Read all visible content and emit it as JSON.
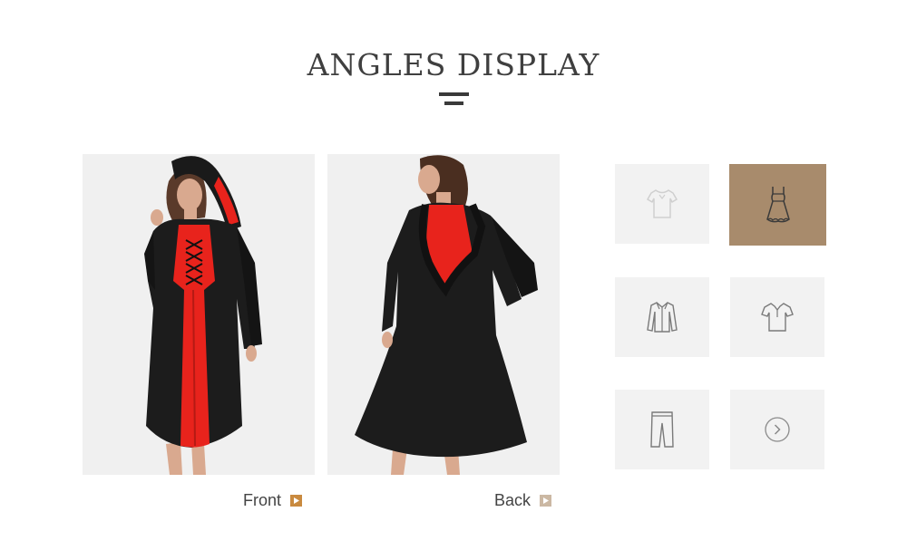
{
  "header": {
    "title": "ANGLES DISPLAY"
  },
  "views": [
    {
      "label": "Front",
      "image_alt": "front-view-photo"
    },
    {
      "label": "Back",
      "image_alt": "back-view-photo"
    }
  ],
  "thumbnails": [
    {
      "icon": "tshirt-icon",
      "active": false
    },
    {
      "icon": "dress-icon",
      "active": true
    },
    {
      "icon": "shirt-icon",
      "active": false
    },
    {
      "icon": "polo-shirt-icon",
      "active": false
    },
    {
      "icon": "pants-icon",
      "active": false
    },
    {
      "icon": "next-arrow-icon",
      "active": false
    }
  ],
  "colors": {
    "accent": "#a88b6c",
    "title_text": "#3f3f3f",
    "photo_bg": "#f0f0f0",
    "thumb_bg": "#f2f2f2",
    "play_front": "#c98a3f",
    "play_back": "#cbb8a3"
  }
}
